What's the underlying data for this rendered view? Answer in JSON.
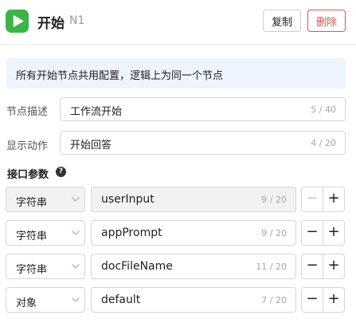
{
  "header": {
    "title": "开始",
    "node_id": "N1",
    "copy_label": "复制",
    "delete_label": "删除",
    "icon": "play-icon"
  },
  "info": {
    "text": "所有开始节点共用配置，逻辑上为同一个节点"
  },
  "fields": {
    "description": {
      "label": "节点描述",
      "value": "工作流开始",
      "count": "5 / 40"
    },
    "display_action": {
      "label": "显示动作",
      "value": "开始回答",
      "count": "4 / 20"
    }
  },
  "interface": {
    "title": "接口参数",
    "help_icon_glyph": "?",
    "params": [
      {
        "type": "字符串",
        "name": "userInput",
        "count": "9 / 20",
        "disabled": true
      },
      {
        "type": "字符串",
        "name": "appPrompt",
        "count": "9 / 20",
        "disabled": false
      },
      {
        "type": "字符串",
        "name": "docFileName",
        "count": "11 / 20",
        "disabled": false
      },
      {
        "type": "对象",
        "name": "default",
        "count": "7 / 20",
        "disabled": false
      }
    ],
    "minus_glyph": "−",
    "plus_glyph": "+"
  },
  "colors": {
    "accent_green": "#3bb54a",
    "danger": "#e35151",
    "info_bg": "#eef4fd"
  }
}
